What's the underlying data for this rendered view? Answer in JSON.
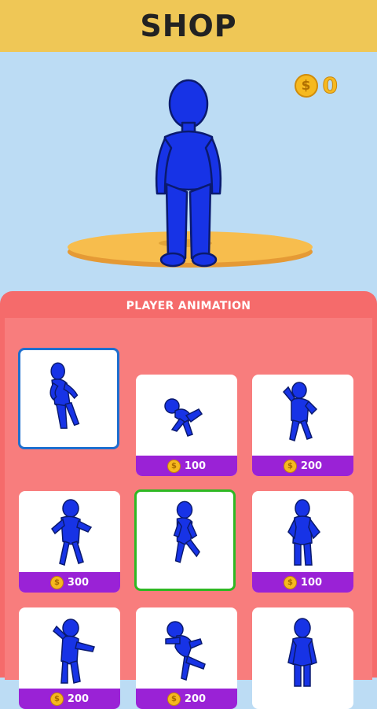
{
  "header": {
    "title": "SHOP"
  },
  "currency": {
    "symbol": "$",
    "balance": "0"
  },
  "panel": {
    "title": "PLAYER ANIMATION"
  },
  "animations": [
    {
      "pose": "idle-lean",
      "price": "",
      "selected": "equipped"
    },
    {
      "pose": "breakdance",
      "price": "100",
      "selected": ""
    },
    {
      "pose": "flex",
      "price": "200",
      "selected": ""
    },
    {
      "pose": "zombie-walk",
      "price": "300",
      "selected": ""
    },
    {
      "pose": "run",
      "price": "",
      "selected": "previewing"
    },
    {
      "pose": "hands-on-hips",
      "price": "100",
      "selected": ""
    },
    {
      "pose": "wave",
      "price": "200",
      "selected": ""
    },
    {
      "pose": "kick",
      "price": "200",
      "selected": ""
    },
    {
      "pose": "stand",
      "price": "",
      "selected": ""
    }
  ],
  "colors": {
    "accent": "#efc756",
    "panel": "#f56b6b",
    "price_bar": "#9a22d6",
    "character": "#1733e6",
    "coin": "#f6b91f"
  }
}
